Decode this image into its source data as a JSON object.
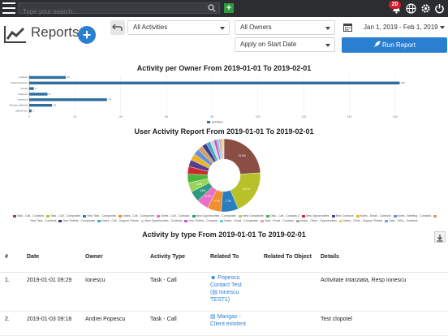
{
  "topbar": {
    "search_placeholder": "Type your search...",
    "plus_label": "+",
    "notification_count": "20"
  },
  "header": {
    "title": "Reports",
    "add_label": "+"
  },
  "filters": {
    "activities_select": "All Activities",
    "owners_select": "All Owners",
    "apply_select": "Apply on Start Date",
    "date_range": "Jan 1, 2019 - Feb 1, 2019",
    "run_label": "Run Report"
  },
  "bar_chart": {
    "title": "Activity per Owner From 2019-01-01 To 2019-02-01",
    "legend": "Activities"
  },
  "pie_chart": {
    "title": "User Activity Report From 2019-01-01 To 2019-02-01"
  },
  "table": {
    "title": "Activity by type From 2019-01-01 To 2019-02-01",
    "headers": [
      "#",
      "Date",
      "Owner",
      "Activity Type",
      "Related To",
      "Related To Object",
      "Details"
    ],
    "rows": [
      {
        "num": "1.",
        "date": "2019-01-01 09:29",
        "owner": "Ionescu",
        "type": "Task - Call",
        "related_line1": "Popescu",
        "related_line2": "Contact Test",
        "related_line3": "Ionescu",
        "related_line4": "TEST1)",
        "related_object": "",
        "details": "Activitate intarziata, Resp Ionescu"
      },
      {
        "num": "2.",
        "date": "2019-01-03 09:18",
        "owner": "Andrei Popescu",
        "type": "Task - Call",
        "related_line1": "Marigaz -",
        "related_line2": "Client existent",
        "related_line3": "",
        "related_line4": "",
        "related_object": "",
        "details": "Test clopotel"
      }
    ]
  },
  "chart_data": [
    {
      "type": "bar",
      "orientation": "horizontal",
      "title": "Activity per Owner From 2019-01-01 To 2019-02-01",
      "categories": [
        "Ionescu",
        "Andrei Popescu",
        "Costel",
        "Popescu",
        "Ionescu2",
        "Popescu Marinel",
        "Marinel Ion"
      ],
      "series": [
        {
          "name": "Activities",
          "values": [
            16,
            162,
            2,
            8,
            34,
            10,
            1
          ]
        }
      ],
      "xlim": [
        0,
        170
      ],
      "ticks": [
        0,
        20,
        40,
        60,
        80,
        100,
        120,
        140,
        160
      ],
      "grid": true,
      "legend_position": "bottom",
      "color": "#2f6e9e"
    },
    {
      "type": "pie",
      "title": "User Activity Report From 2019-01-01 To 2019-02-01",
      "labels": [
        "Task - Call - Contacts",
        "Task - Call - Companies",
        "New Task - Companies",
        "Notes - Call - Companies",
        "Notes - Call - Contacts",
        "New Opportunities - Companies",
        "New Companies",
        "Task - Call - Contacts 2",
        "New Opportunities",
        "New Contacts",
        "Notes - Email - Contacts",
        "Notes - Meeting - Contacts",
        "New Task - Contacts",
        "New Tickets - Companies",
        "Notes - Call - Support Tickets",
        "New Opportunities - Contacts",
        "New Tickets - Contacts",
        "Notes - Email - Companies",
        "Task - Email - Contacts",
        "Notes - Other - Opportunities",
        "Notes - Other - Support Tickets",
        "Task - ToDo - Contacts"
      ],
      "values": [
        23.9,
        19.7,
        7.7,
        6.1,
        5.3,
        4.8,
        4.2,
        3.8,
        3.4,
        3.1,
        2.9,
        2.6,
        2.3,
        2.1,
        1.9,
        1.6,
        1.3,
        1.0,
        0.9,
        0.6,
        0.5,
        0.3
      ],
      "colors": [
        "#8b4e44",
        "#b9c12a",
        "#2a7dbf",
        "#f08f2d",
        "#e970c9",
        "#2a9c7c",
        "#9bd35a",
        "#46b73b",
        "#c92b2b",
        "#5a3c8e",
        "#e8b526",
        "#6a8fd6",
        "#d2a06c",
        "#3b3b8c",
        "#4aa6c9",
        "#d6d6d6",
        "#bf57c5",
        "#6ed0c8",
        "#f29ab0",
        "#a5a5a5",
        "#e3d46a",
        "#7aa7cc"
      ],
      "legend_position": "bottom"
    }
  ]
}
